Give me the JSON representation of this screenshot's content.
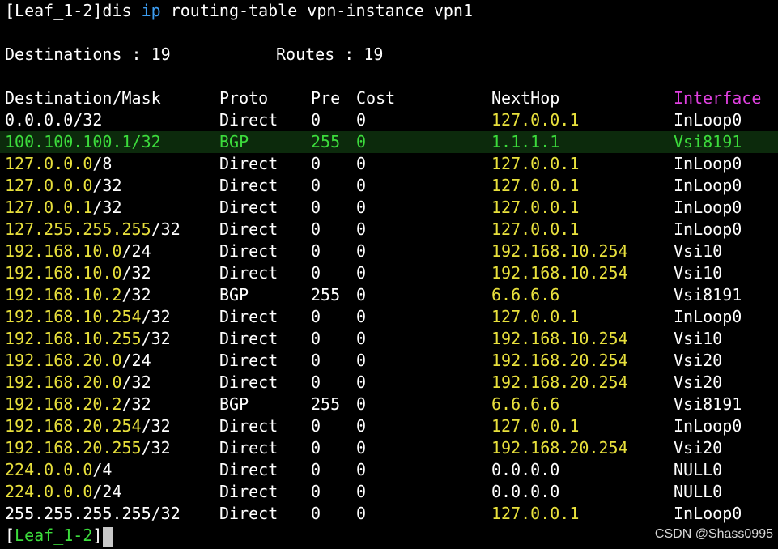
{
  "command": {
    "prompt": "[Leaf_1-2]",
    "cmd_pre": "dis ",
    "cmd_kw": "ip",
    "cmd_post": " routing-table vpn-instance vpn1"
  },
  "summary": {
    "destinations_label": "Destinations : ",
    "destinations_value": "19",
    "routes_label": "Routes : ",
    "routes_value": "19"
  },
  "table": {
    "headers": {
      "dest": "Destination/Mask",
      "proto": "Proto",
      "pre": "Pre",
      "cost": "Cost",
      "nexthop": "NextHop",
      "iface": "Interface"
    },
    "rows": [
      {
        "addr": "0.0.0.0",
        "mask": "/32",
        "proto": "Direct",
        "pre": "0",
        "cost": "0",
        "nexthop": "127.0.0.1",
        "iface": "InLoop0"
      },
      {
        "addr": "100.100.100.1",
        "mask": "/32",
        "proto": "BGP",
        "pre": "255",
        "cost": "0",
        "nexthop": "1.1.1.1",
        "iface": "Vsi8191"
      },
      {
        "addr": "127.0.0.0",
        "mask": "/8",
        "proto": "Direct",
        "pre": "0",
        "cost": "0",
        "nexthop": "127.0.0.1",
        "iface": "InLoop0"
      },
      {
        "addr": "127.0.0.0",
        "mask": "/32",
        "proto": "Direct",
        "pre": "0",
        "cost": "0",
        "nexthop": "127.0.0.1",
        "iface": "InLoop0"
      },
      {
        "addr": "127.0.0.1",
        "mask": "/32",
        "proto": "Direct",
        "pre": "0",
        "cost": "0",
        "nexthop": "127.0.0.1",
        "iface": "InLoop0"
      },
      {
        "addr": "127.255.255.255",
        "mask": "/32",
        "proto": "Direct",
        "pre": "0",
        "cost": "0",
        "nexthop": "127.0.0.1",
        "iface": "InLoop0"
      },
      {
        "addr": "192.168.10.0",
        "mask": "/24",
        "proto": "Direct",
        "pre": "0",
        "cost": "0",
        "nexthop": "192.168.10.254",
        "iface": "Vsi10"
      },
      {
        "addr": "192.168.10.0",
        "mask": "/32",
        "proto": "Direct",
        "pre": "0",
        "cost": "0",
        "nexthop": "192.168.10.254",
        "iface": "Vsi10"
      },
      {
        "addr": "192.168.10.2",
        "mask": "/32",
        "proto": "BGP",
        "pre": "255",
        "cost": "0",
        "nexthop": "6.6.6.6",
        "iface": "Vsi8191"
      },
      {
        "addr": "192.168.10.254",
        "mask": "/32",
        "proto": "Direct",
        "pre": "0",
        "cost": "0",
        "nexthop": "127.0.0.1",
        "iface": "InLoop0"
      },
      {
        "addr": "192.168.10.255",
        "mask": "/32",
        "proto": "Direct",
        "pre": "0",
        "cost": "0",
        "nexthop": "192.168.10.254",
        "iface": "Vsi10"
      },
      {
        "addr": "192.168.20.0",
        "mask": "/24",
        "proto": "Direct",
        "pre": "0",
        "cost": "0",
        "nexthop": "192.168.20.254",
        "iface": "Vsi20"
      },
      {
        "addr": "192.168.20.0",
        "mask": "/32",
        "proto": "Direct",
        "pre": "0",
        "cost": "0",
        "nexthop": "192.168.20.254",
        "iface": "Vsi20"
      },
      {
        "addr": "192.168.20.2",
        "mask": "/32",
        "proto": "BGP",
        "pre": "255",
        "cost": "0",
        "nexthop": "6.6.6.6",
        "iface": "Vsi8191"
      },
      {
        "addr": "192.168.20.254",
        "mask": "/32",
        "proto": "Direct",
        "pre": "0",
        "cost": "0",
        "nexthop": "127.0.0.1",
        "iface": "InLoop0"
      },
      {
        "addr": "192.168.20.255",
        "mask": "/32",
        "proto": "Direct",
        "pre": "0",
        "cost": "0",
        "nexthop": "192.168.20.254",
        "iface": "Vsi20"
      },
      {
        "addr": "224.0.0.0",
        "mask": "/4",
        "proto": "Direct",
        "pre": "0",
        "cost": "0",
        "nexthop": "0.0.0.0",
        "iface": "NULL0"
      },
      {
        "addr": "224.0.0.0",
        "mask": "/24",
        "proto": "Direct",
        "pre": "0",
        "cost": "0",
        "nexthop": "0.0.0.0",
        "iface": "NULL0"
      },
      {
        "addr": "255.255.255.255",
        "mask": "/32",
        "proto": "Direct",
        "pre": "0",
        "cost": "0",
        "nexthop": "127.0.0.1",
        "iface": "InLoop0"
      }
    ]
  },
  "footer_prompt": {
    "open": "[",
    "name": "Leaf_1-2",
    "close": "]"
  },
  "watermark": "CSDN @Shass0995",
  "colors": {
    "background": "#000000",
    "text": "#ffffff",
    "address": "#e8e03c",
    "highlight_text": "#3cdc3c",
    "highlight_bg": "#0c2a0c",
    "header_accent": "#e040e0",
    "keyword": "#3c9cf0"
  }
}
